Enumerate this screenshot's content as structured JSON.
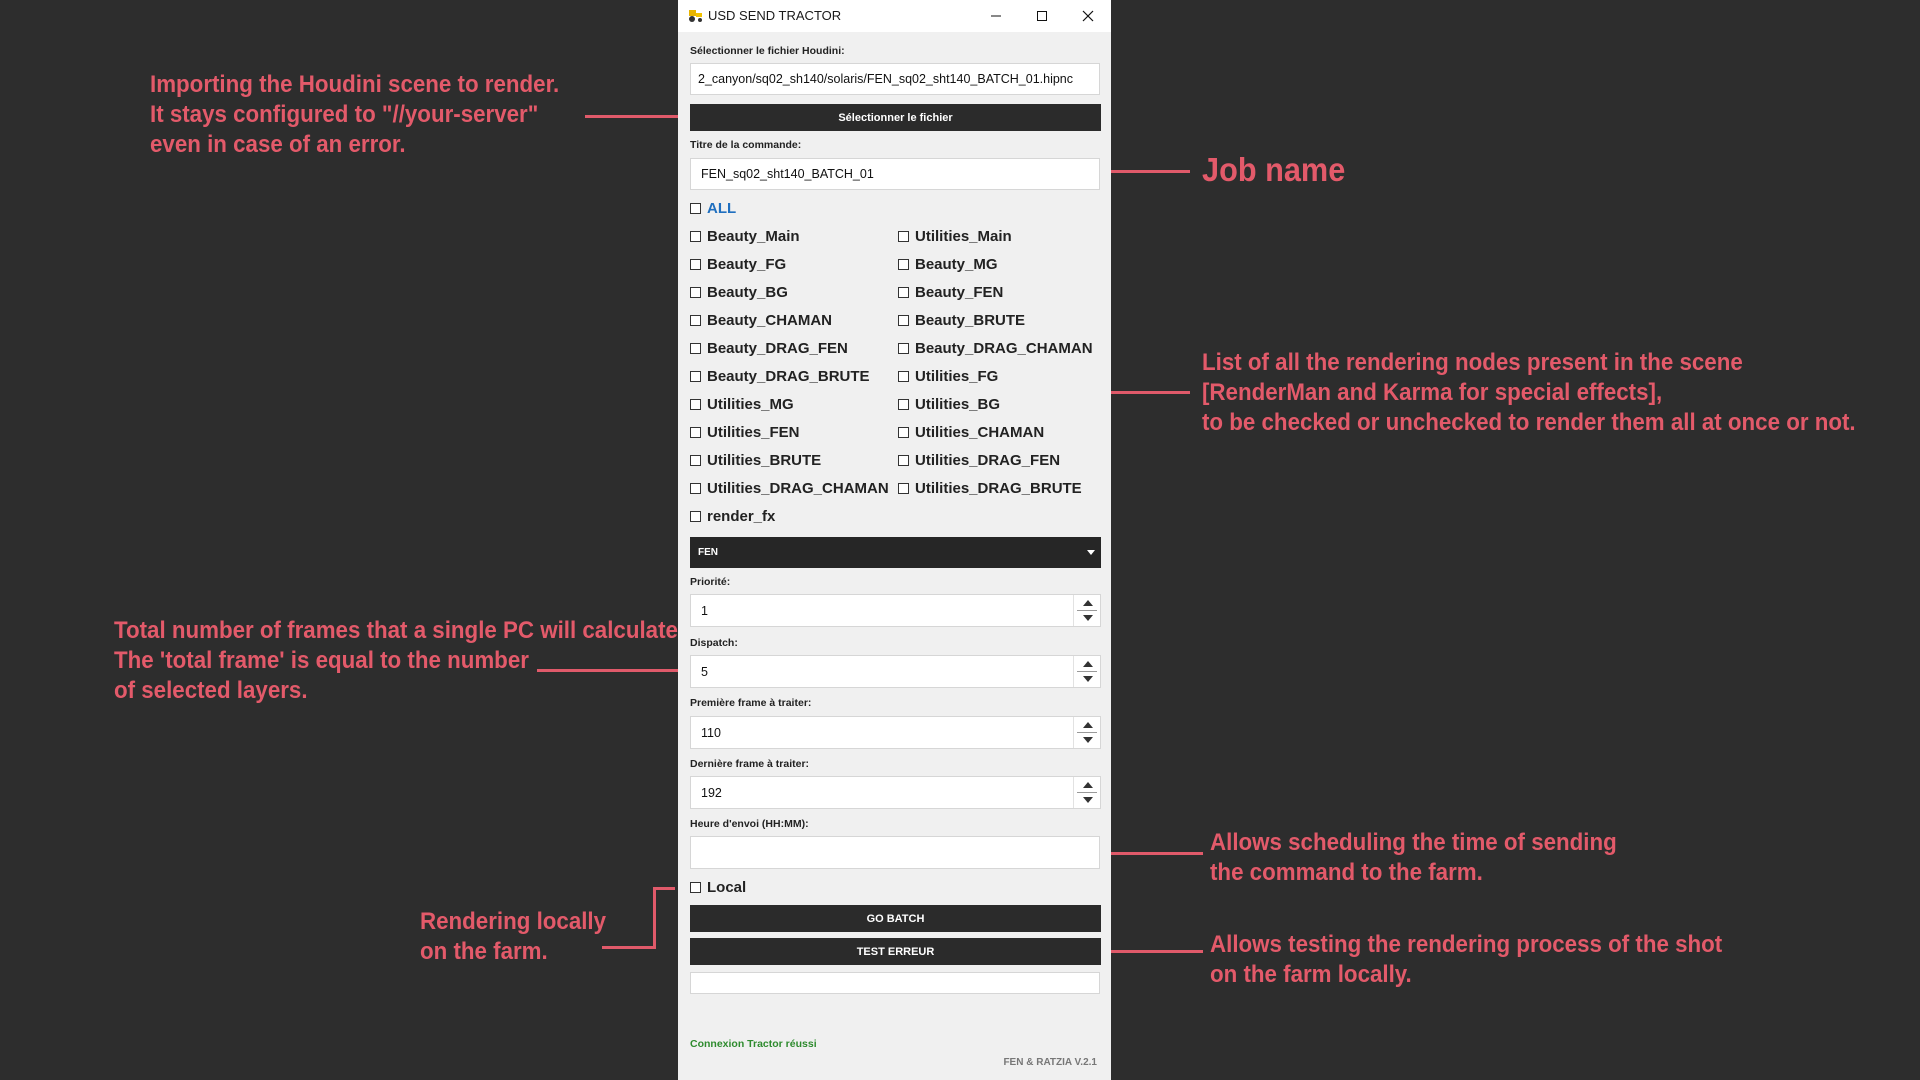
{
  "window": {
    "title": "USD SEND TRACTOR"
  },
  "file": {
    "label": "Sélectionner le fichier Houdini:",
    "value": "2_canyon/sq02_sh140/solaris/FEN_sq02_sht140_BATCH_01.hipnc",
    "button": "Sélectionner le fichier"
  },
  "command": {
    "label": "Titre de la commande:",
    "value": "FEN_sq02_sht140_BATCH_01"
  },
  "layers": {
    "all": "ALL",
    "left": [
      "Beauty_Main",
      "Beauty_FG",
      "Beauty_BG",
      "Beauty_CHAMAN",
      "Beauty_DRAG_FEN",
      "Beauty_DRAG_BRUTE",
      "Utilities_MG",
      "Utilities_FEN",
      "Utilities_BRUTE",
      "Utilities_DRAG_CHAMAN",
      "render_fx"
    ],
    "right": [
      "Utilities_Main",
      "Beauty_MG",
      "Beauty_FEN",
      "Beauty_BRUTE",
      "Beauty_DRAG_CHAMAN",
      "Utilities_FG",
      "Utilities_BG",
      "Utilities_CHAMAN",
      "Utilities_DRAG_FEN",
      "Utilities_DRAG_BRUTE"
    ]
  },
  "dropdown": {
    "selected": "FEN"
  },
  "priority": {
    "label": "Priorité:",
    "value": "1"
  },
  "dispatch": {
    "label": "Dispatch:",
    "value": "5"
  },
  "first_frame": {
    "label": "Première frame à traiter:",
    "value": "110"
  },
  "last_frame": {
    "label": "Dernière frame à traiter:",
    "value": "192"
  },
  "send_time": {
    "label": "Heure d'envoi (HH:MM):",
    "value": ""
  },
  "local": {
    "label": "Local"
  },
  "buttons": {
    "go_batch": "GO BATCH",
    "test_erreur": "TEST ERREUR"
  },
  "status": "Connexion Tractor réussi",
  "version": "FEN & RATZIA  V.2.1",
  "annotations": {
    "import": [
      "Importing the Houdini scene to render.",
      "It stays configured to \"//your-server\"",
      "even in case of an error."
    ],
    "job_name": "Job name",
    "nodes": [
      "List of all the rendering nodes present in the scene",
      "[RenderMan and Karma for special effects],",
      "to be checked or unchecked to render them all at once or not."
    ],
    "dispatch": [
      "Total number of frames that a single PC will calculate.",
      "The 'total frame' is equal to the number",
      "of selected layers."
    ],
    "schedule": [
      "Allows scheduling the time of sending",
      "the command to the farm."
    ],
    "local": [
      "Rendering locally",
      "on the farm."
    ],
    "test": [
      "Allows testing the rendering process of the shot",
      "on the farm locally."
    ]
  },
  "colors": {
    "annotation": "#e35a6a",
    "background": "#2d2d2d",
    "button": "#2b2b2b",
    "status": "#2e8b2e",
    "all_label": "#1f6fbf"
  }
}
